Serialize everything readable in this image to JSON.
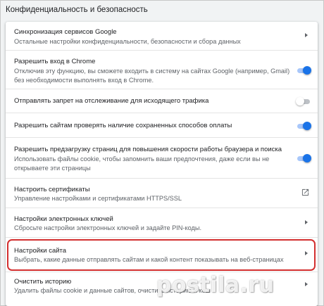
{
  "section": {
    "title": "Конфиденциальность и безопасность"
  },
  "rows": [
    {
      "label": "Синхронизация сервисов Google",
      "sub": "Остальные настройки конфиденциальности, безопасности и сбора данных",
      "control": "arrow"
    },
    {
      "label": "Разрешить вход в Chrome",
      "sub": "Отключив эту функцию, вы сможете входить в систему на сайтах Google (например, Gmail) без необходимости выполнять вход в Chrome.",
      "control": "toggle",
      "toggle_on": true
    },
    {
      "label": "Отправлять запрет на отслеживание для исходящего трафика",
      "control": "toggle",
      "toggle_on": false
    },
    {
      "label": "Разрешить сайтам проверять наличие сохраненных способов оплаты",
      "control": "toggle",
      "toggle_on": true
    },
    {
      "label": "Разрешить предзагрузку страниц для повышения скорости работы браузера и поиска",
      "sub": "Использовать файлы cookie, чтобы запомнить ваши предпочтения, даже если вы не открываете эти страницы",
      "control": "toggle",
      "toggle_on": true
    },
    {
      "label": "Настроить сертификаты",
      "sub": "Управление настройками и сертификатами HTTPS/SSL",
      "control": "external-link"
    },
    {
      "label": "Настройки электронных ключей",
      "sub": "Сбросьте настройки электронных ключей и задайте PIN-коды.",
      "control": "arrow"
    },
    {
      "label": "Настройки сайта",
      "sub": "Выбрать, какие данные отправлять сайтам и какой контент показывать на веб-страницах",
      "control": "arrow",
      "highlighted": true
    },
    {
      "label": "Очистить историю",
      "sub": "Удалить файлы cookie и данные сайтов, очистить историю и кеш",
      "control": "arrow"
    }
  ],
  "colors": {
    "accent": "#1a73e8",
    "highlight": "#d32f2f"
  },
  "watermark": "postila.ru"
}
